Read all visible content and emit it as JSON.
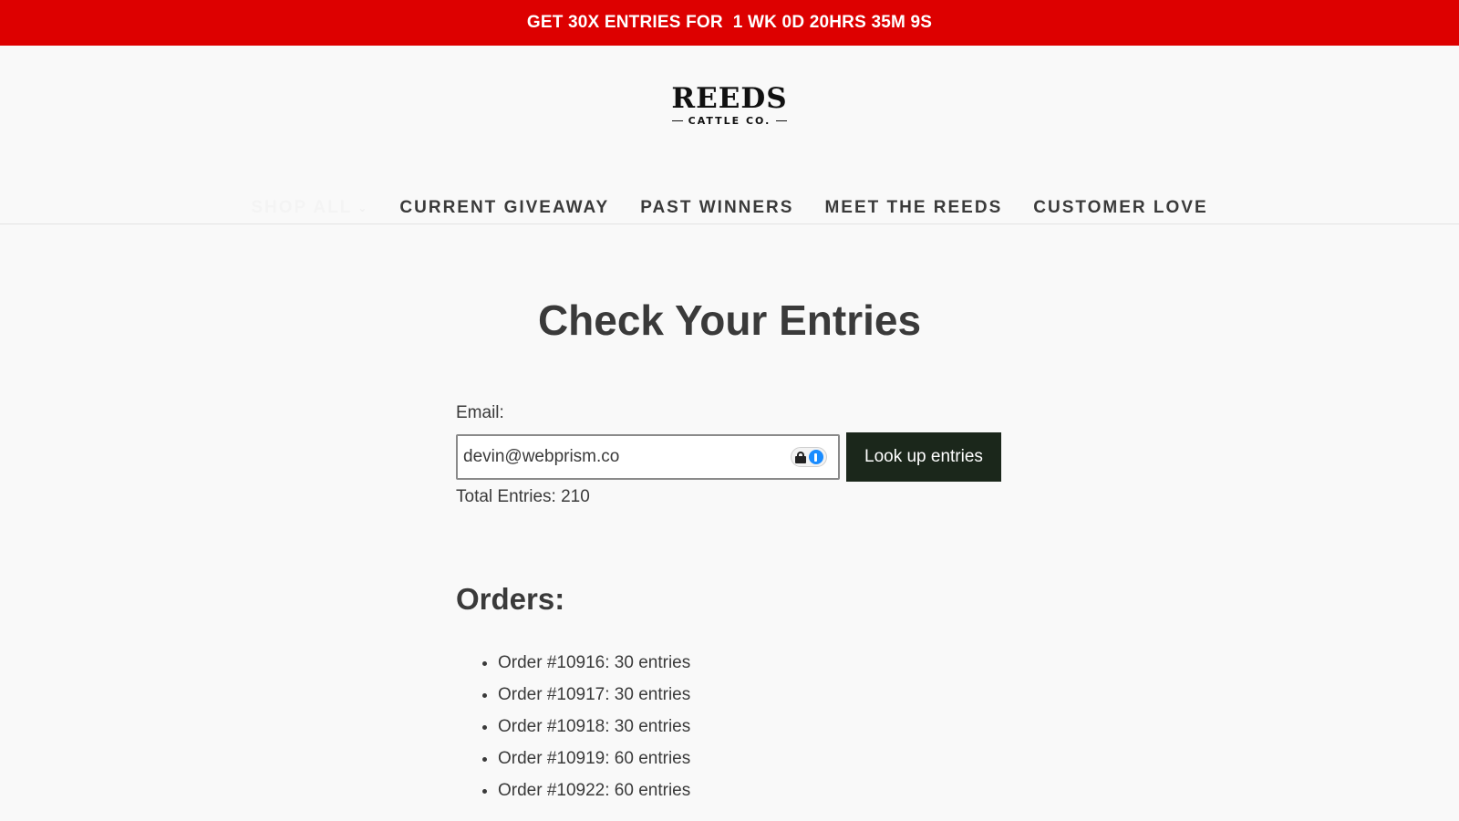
{
  "announcement": {
    "text": "GET 30X ENTRIES FOR  1 WK 0D 20HRS 35M 9S"
  },
  "logo": {
    "name": "REEDS",
    "subtitle": "CATTLE CO."
  },
  "nav": {
    "items": [
      {
        "label": "SHOP ALL",
        "has_dropdown": true
      },
      {
        "label": "CURRENT GIVEAWAY"
      },
      {
        "label": "PAST WINNERS"
      },
      {
        "label": "MEET THE REEDS"
      },
      {
        "label": "CUSTOMER LOVE"
      }
    ]
  },
  "main": {
    "title": "Check Your Entries",
    "email_label": "Email:",
    "email_value": "devin@webprism.co",
    "lookup_label": "Look up entries",
    "total_entries": "Total Entries: 210",
    "orders_title": "Orders:",
    "orders": [
      {
        "text": "Order #10916: 30 entries"
      },
      {
        "text": "Order #10917: 30 entries"
      },
      {
        "text": "Order #10918: 30 entries"
      },
      {
        "text": "Order #10919: 60 entries"
      },
      {
        "text": "Order #10922: 60 entries"
      }
    ]
  },
  "colors": {
    "announcement_bg": "#dd0000",
    "button_bg": "#1b271b",
    "text": "#3a3a3a",
    "page_bg": "#f9f9f9"
  }
}
